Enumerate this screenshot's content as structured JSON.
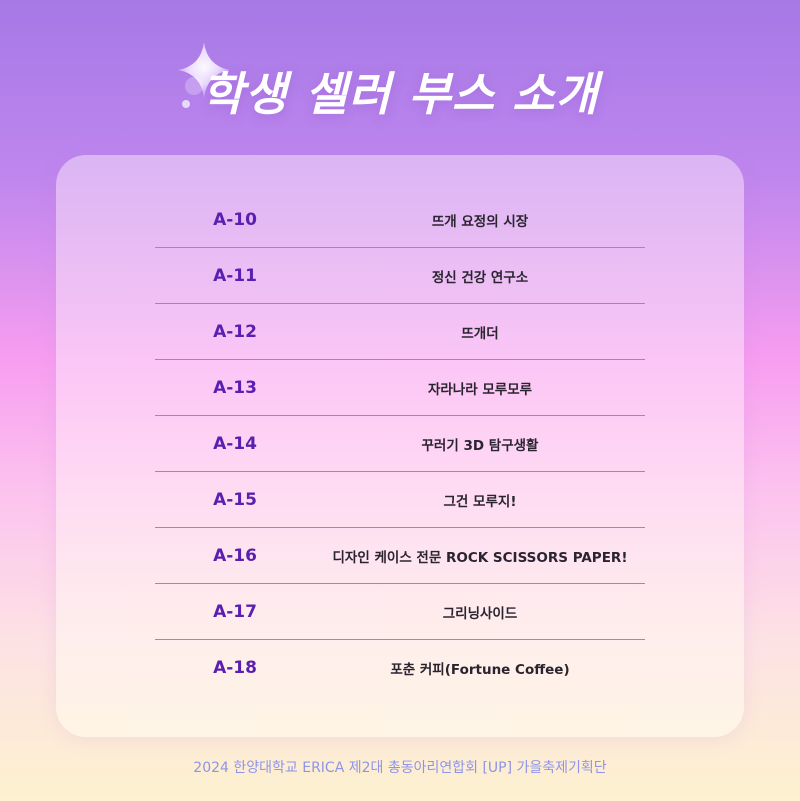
{
  "title": "학생 셀러 부스 소개",
  "booths": [
    {
      "code": "A-10",
      "name": "뜨개 요정의 시장"
    },
    {
      "code": "A-11",
      "name": "정신 건강 연구소"
    },
    {
      "code": "A-12",
      "name": "뜨개더"
    },
    {
      "code": "A-13",
      "name": "자라나라 모루모루"
    },
    {
      "code": "A-14",
      "name": "꾸러기 3D 탐구생활"
    },
    {
      "code": "A-15",
      "name": "그건 모루지!"
    },
    {
      "code": "A-16",
      "name": "디자인 케이스 전문 ROCK SCISSORS PAPER!"
    },
    {
      "code": "A-17",
      "name": "그리닝사이드"
    },
    {
      "code": "A-18",
      "name": "포춘 커피(Fortune Coffee)"
    }
  ],
  "footer": "2024 한양대학교 ERICA 제2대 총동아리연합회 [UP] 가을축제기획단",
  "colors": {
    "accent": "#5a1fb0",
    "footer": "#8e95e8"
  },
  "icons": {
    "decoration": "sparkle-icon"
  }
}
